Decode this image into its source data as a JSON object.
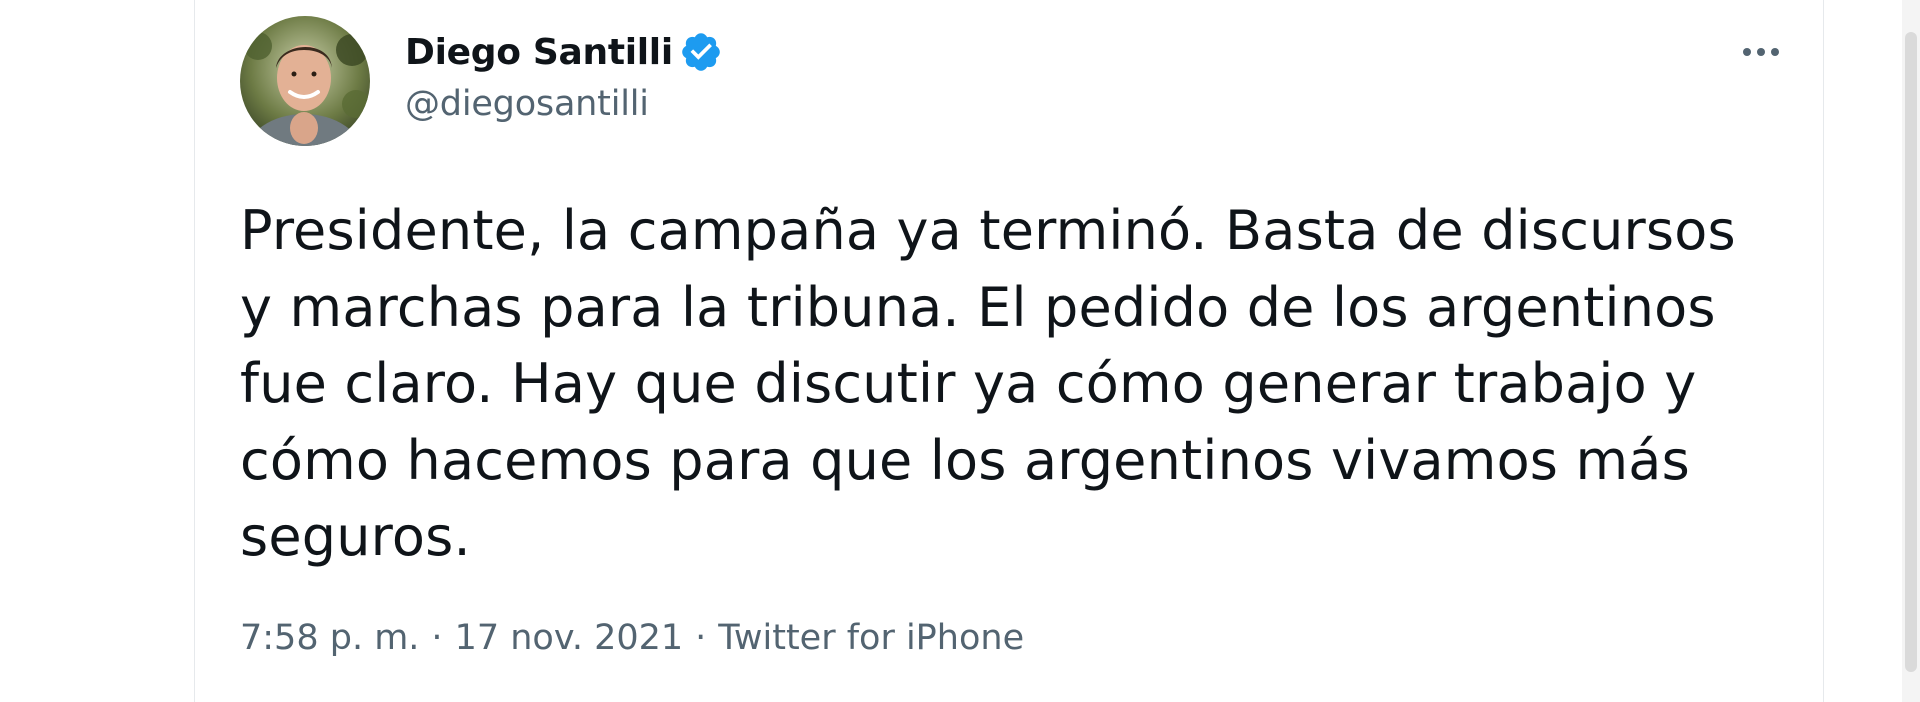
{
  "tweet": {
    "author": {
      "name": "Diego Santilli",
      "handle": "@diegosantilli",
      "verified": true,
      "avatar_icon": "profile-photo"
    },
    "more_icon": "more-horizontal-icon",
    "text": "Presidente, la campaña ya terminó. Basta de discursos\ny marchas para la tribuna. El pedido de los argentinos\nfue claro. Hay que discutir ya cómo generar trabajo y\ncómo hacemos para que los argentinos vivamos más\nseguros.",
    "time": "7:58 p. m.",
    "date": "17 nov. 2021",
    "source": "Twitter for iPhone",
    "separator": "·"
  },
  "colors": {
    "verified_blue": "#1d9bf0",
    "text_primary": "#0f1419",
    "text_secondary": "#536471",
    "border": "#e6e9ec"
  }
}
